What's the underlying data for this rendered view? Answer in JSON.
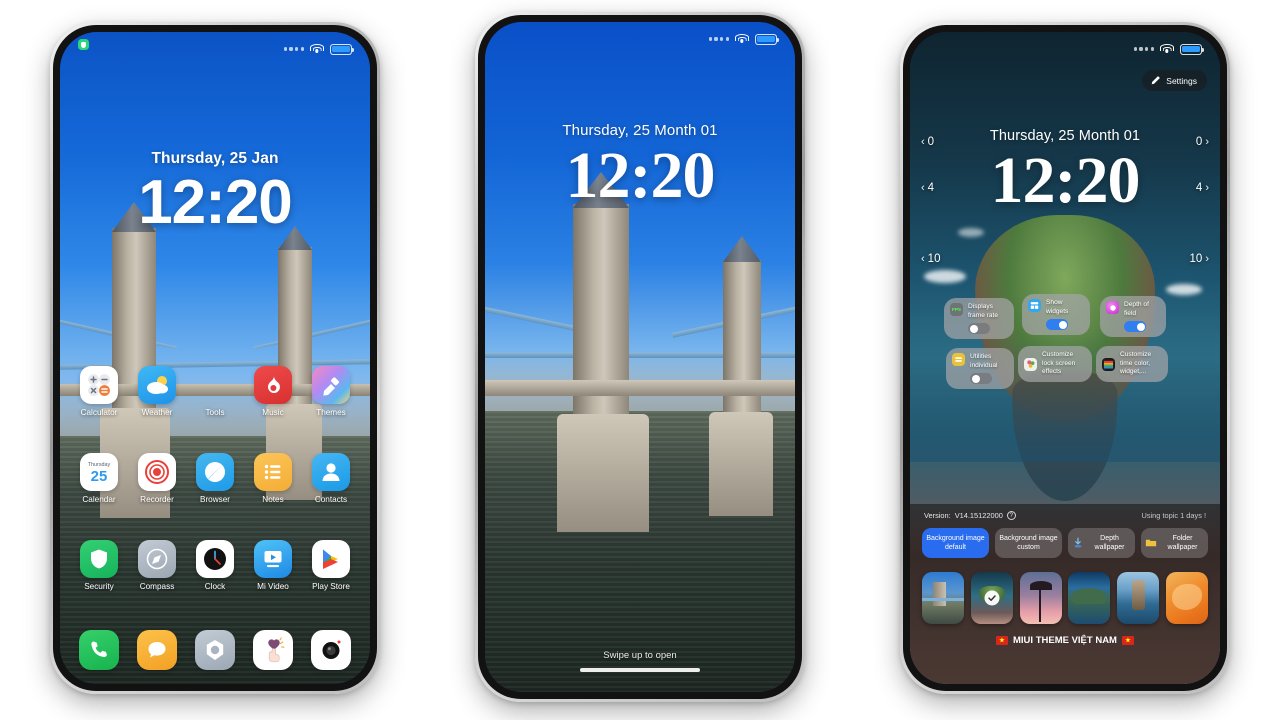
{
  "page": {
    "background": "#ffffff"
  },
  "phone1": {
    "name": "home-screen",
    "status": {
      "signal_dots": 4,
      "wifi": "wifi-icon",
      "battery": "battery-icon",
      "privacy_dot": "shield-indicator"
    },
    "lock": {
      "date": "Thursday, 25 Jan",
      "time": "12:20"
    },
    "rows": [
      [
        {
          "label": "Calculator",
          "icon": "calculator-icon"
        },
        {
          "label": "Weather",
          "icon": "weather-icon"
        },
        {
          "label": "Tools",
          "icon": "tools-folder-icon"
        },
        {
          "label": "Music",
          "icon": "music-icon"
        },
        {
          "label": "Themes",
          "icon": "themes-icon"
        }
      ],
      [
        {
          "label": "Calendar",
          "icon": "calendar-icon",
          "day_name": "Thursday",
          "day_num": "25"
        },
        {
          "label": "Recorder",
          "icon": "recorder-icon"
        },
        {
          "label": "Browser",
          "icon": "browser-icon"
        },
        {
          "label": "Notes",
          "icon": "notes-icon"
        },
        {
          "label": "Contacts",
          "icon": "contacts-icon"
        }
      ],
      [
        {
          "label": "Security",
          "icon": "security-icon"
        },
        {
          "label": "Compass",
          "icon": "compass-icon"
        },
        {
          "label": "Clock",
          "icon": "clock-icon"
        },
        {
          "label": "Mi Video",
          "icon": "mi-video-icon"
        },
        {
          "label": "Play Store",
          "icon": "play-store-icon"
        }
      ]
    ],
    "dock": [
      {
        "label": "Phone",
        "icon": "phone-icon"
      },
      {
        "label": "Messages",
        "icon": "messages-icon"
      },
      {
        "label": "Settings",
        "icon": "settings-icon"
      },
      {
        "label": "Touch Assistant",
        "icon": "touch-heart-icon"
      },
      {
        "label": "Camera",
        "icon": "camera-icon"
      }
    ]
  },
  "phone2": {
    "name": "lock-screen",
    "lock": {
      "date": "Thursday, 25 Month 01",
      "time": "12:20"
    },
    "swipe_hint": "Swipe up to open"
  },
  "phone3": {
    "name": "lock-screen-editor",
    "lock": {
      "date": "Thursday, 25 Month 01",
      "time": "12:20"
    },
    "settings_button": {
      "label": "Settings",
      "icon": "pencil-icon"
    },
    "side_controls": {
      "left": [
        {
          "value": "0",
          "chevron": "chevron-left-icon"
        },
        {
          "value": "4",
          "chevron": "chevron-left-icon"
        },
        {
          "value": "10",
          "chevron": "chevron-left-icon"
        }
      ],
      "right": [
        {
          "value": "0",
          "chevron": "chevron-right-icon"
        },
        {
          "value": "4",
          "chevron": "chevron-right-icon"
        },
        {
          "value": "10",
          "chevron": "chevron-right-icon"
        }
      ]
    },
    "cards": [
      {
        "id": "fps",
        "text": "Displays\nframe rate",
        "icon": "fps-icon",
        "icon_text": "FPS",
        "icon_color": "#6f7276",
        "toggle": "off"
      },
      {
        "id": "show-widgets",
        "text": "Show\nwidgets",
        "icon": "widgets-icon",
        "icon_color": "#35a7ef",
        "toggle": "on"
      },
      {
        "id": "depth-of-field",
        "text": "Depth of\nfield",
        "icon": "depth-icon",
        "icon_color": "#d63ae0",
        "toggle": "on"
      },
      {
        "id": "utilities",
        "text": "Utilities\nindividual",
        "icon": "utilities-icon",
        "icon_color": "#e8c23c",
        "toggle": "off"
      },
      {
        "id": "lock-screen-effects",
        "text": "Customize\nlock screen\neffects",
        "icon": "effects-icon",
        "icon_color": "#ffffff",
        "toggle": null
      },
      {
        "id": "time-color",
        "text": "Customize\ntime color,\nwidget,...",
        "icon": "time-color-icon",
        "icon_color": "#222222",
        "toggle": null
      }
    ],
    "editor": {
      "version_label": "Version:",
      "version_value": "V14.15122000",
      "help_icon": "question-mark-icon",
      "topic_status": "Using topic 1 days !",
      "buttons": [
        {
          "label": "Background\nimage default",
          "active": true,
          "icon": null
        },
        {
          "label": "Background\nimage custom",
          "active": false,
          "icon": null
        },
        {
          "label": "Depth\nwallpaper",
          "active": false,
          "icon": "depth-wallpaper-icon"
        },
        {
          "label": "Folder\nwallpaper",
          "active": false,
          "icon": "folder-icon"
        }
      ],
      "thumbnails": [
        {
          "id": "tower-bridge",
          "selected": false
        },
        {
          "id": "floating-island",
          "selected": true
        },
        {
          "id": "palm-sunset",
          "selected": false
        },
        {
          "id": "big-sur-coast",
          "selected": false
        },
        {
          "id": "sea-cliff",
          "selected": false
        },
        {
          "id": "orange-abstract",
          "selected": false
        }
      ],
      "brand": "MIUI THEME VIỆT NAM",
      "brand_flag": "vietnam-flag-icon",
      "accent_color": "#2a6cf0"
    }
  }
}
